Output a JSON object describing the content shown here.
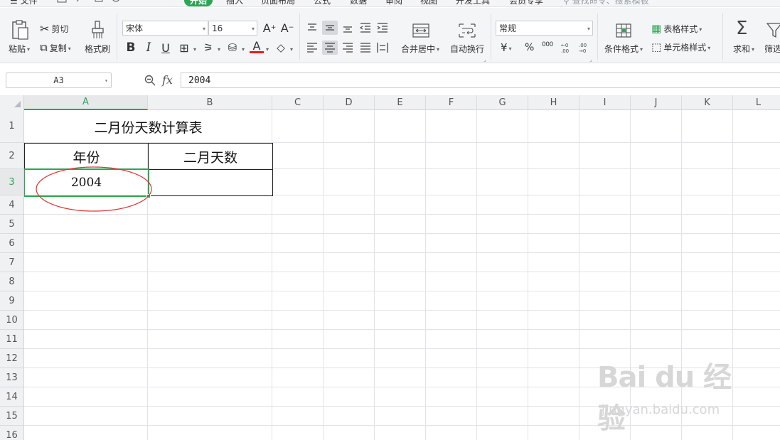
{
  "menu": {
    "file": "文件",
    "tabs": [
      "开始",
      "插入",
      "页面布局",
      "公式",
      "数据",
      "审阅",
      "视图",
      "开发工具",
      "会员专享"
    ],
    "search_placeholder": "查找命令、搜索模板"
  },
  "ribbon": {
    "paste": "粘贴",
    "cut": "剪切",
    "copy": "复制",
    "format_painter": "格式刷",
    "font_name": "宋体",
    "font_size": "16",
    "merge_center": "合并居中",
    "wrap_text": "自动换行",
    "number_format": "常规",
    "currency_symbol": "¥",
    "percent": "%",
    "thousands": "000",
    "conditional_format": "条件格式",
    "table_style": "表格样式",
    "cell_style": "单元格样式",
    "sum": "求和",
    "filter": "筛选",
    "bold": "B",
    "italic": "I",
    "underline": "U",
    "font_color_glyph": "A"
  },
  "formula_bar": {
    "name_box": "A3",
    "fx": "fx",
    "content": "2004"
  },
  "sheet": {
    "columns": [
      "A",
      "B",
      "C",
      "D",
      "E",
      "F",
      "G",
      "H",
      "I",
      "J",
      "K",
      "L"
    ],
    "rows": [
      "1",
      "2",
      "3",
      "4",
      "5",
      "6",
      "7",
      "8",
      "9",
      "10",
      "11",
      "12",
      "13",
      "14",
      "15",
      "16"
    ],
    "selected_cell": "A3",
    "title": "二月份天数计算表",
    "header_year": "年份",
    "header_days": "二月天数",
    "a3_value": "2004",
    "b3_value": ""
  },
  "colors": {
    "accent": "#2ca655",
    "annotation_ellipse": "#e03030",
    "grid_line": "#e1e3e6"
  },
  "watermark": {
    "logo": "Bai du 经验",
    "url": "jingyan.baidu.com"
  }
}
